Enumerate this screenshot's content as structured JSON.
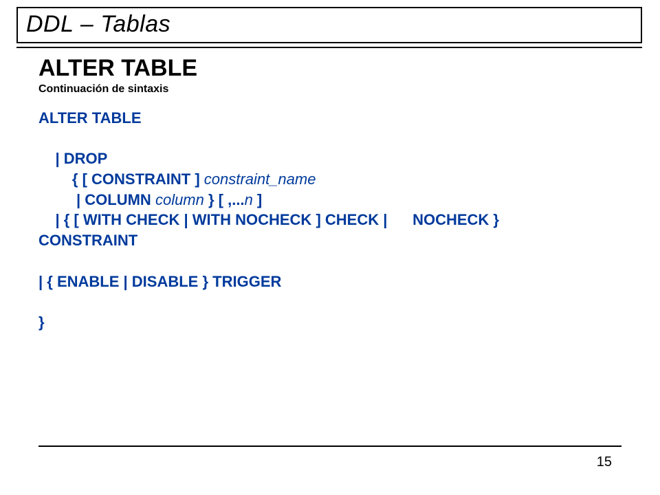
{
  "slide": {
    "title": "DDL – Tablas",
    "heading": "ALTER TABLE",
    "subtitle": "Continuación de sintaxis",
    "syntax": {
      "l1": "ALTER TABLE",
      "l2_pipe": "    | ",
      "l2_drop": "DROP",
      "l3_open": "        { [ ",
      "l3_constraint": "CONSTRAINT",
      "l3_close": " ] ",
      "l3_arg": "constraint_name",
      "l4_pipe": "         | ",
      "l4_column": "COLUMN",
      "l4_sp": " ",
      "l4_arg": "column",
      "l4_mid": " } [ ,...",
      "l4_n": "n",
      "l4_end": " ]",
      "l5_pipe": "    | { [ ",
      "l5_with_check": "WITH CHECK",
      "l5_bar1": " | ",
      "l5_with_nocheck": "WITH NOCHECK",
      "l5_close": " ] ",
      "l5_check": "CHECK",
      "l5_bar2": " |      ",
      "l5_nocheck": "NOCHECK",
      "l5_end": " }",
      "l6": "CONSTRAINT",
      "l7_open": "| { ",
      "l7_enable": "ENABLE",
      "l7_bar": " | ",
      "l7_disable": "DISABLE",
      "l7_close": " } ",
      "l7_trigger": "TRIGGER",
      "l8": "}"
    },
    "page": "15"
  }
}
